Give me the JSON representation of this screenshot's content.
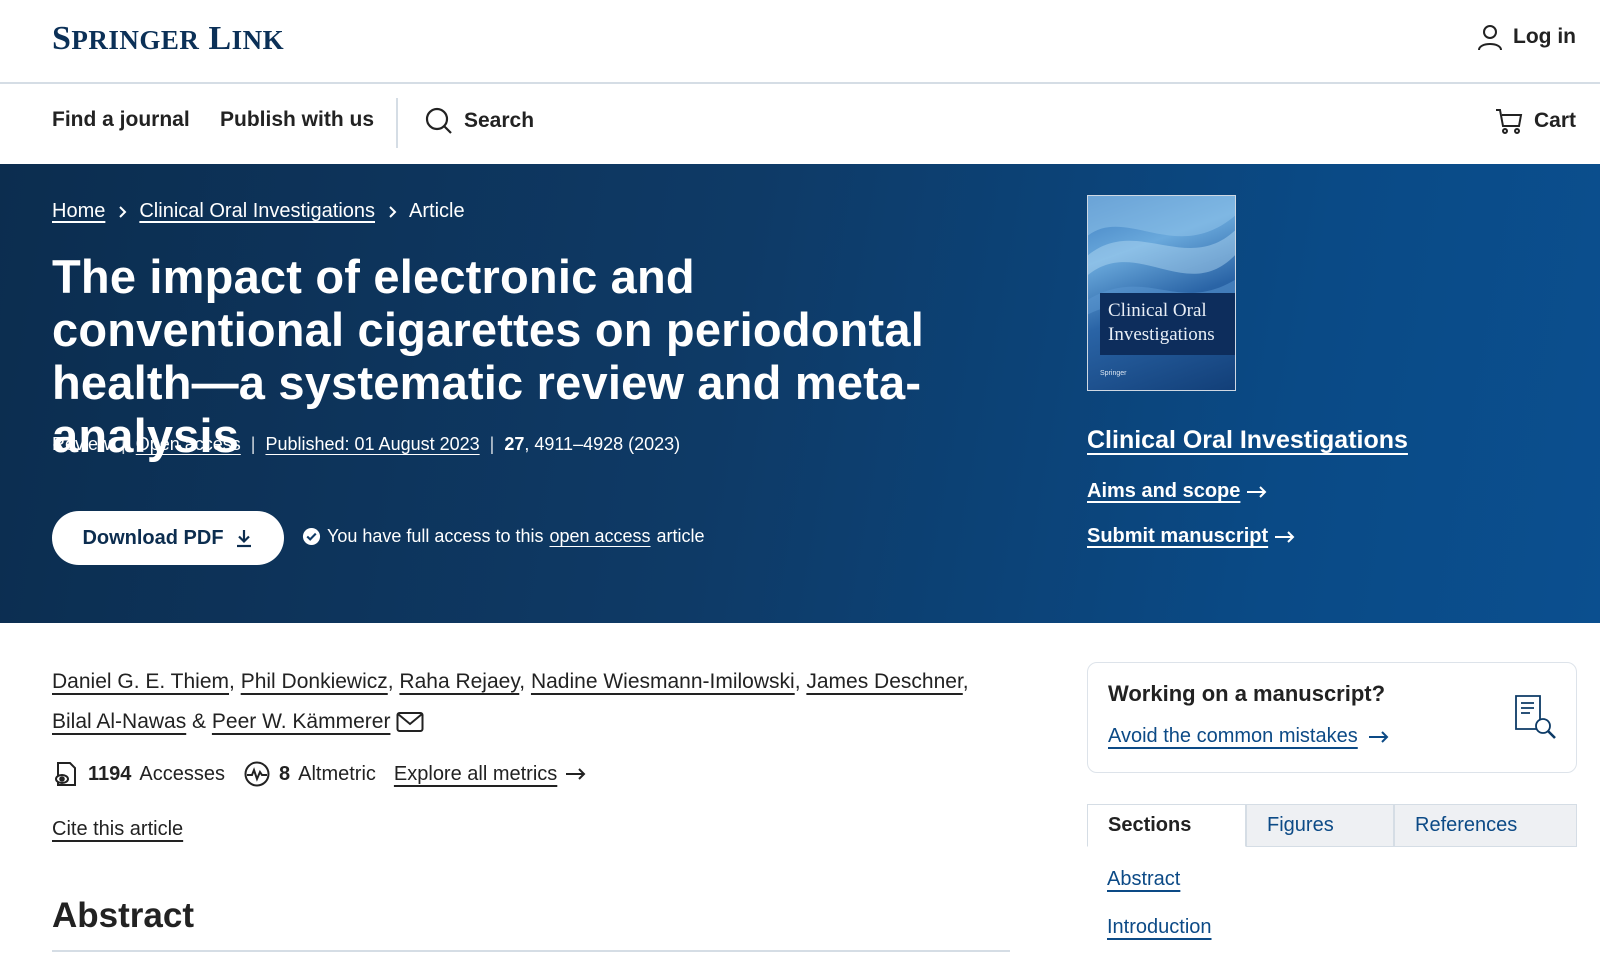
{
  "header": {
    "logo_text_1": "S",
    "logo_text_2": "PRINGER",
    "logo_text_3": " L",
    "logo_text_4": "INK",
    "login_label": "Log in"
  },
  "nav": {
    "find_journal": "Find a journal",
    "publish": "Publish with us",
    "search": "Search",
    "cart": "Cart"
  },
  "breadcrumb": {
    "home": "Home",
    "journal": "Clinical Oral Investigations",
    "current": "Article"
  },
  "article": {
    "title": "The impact of electronic and conventional cigarettes on periodontal health—a systematic review and meta-analysis",
    "type": "Review",
    "open_access": "Open access",
    "published": "Published: 01 August 2023",
    "volume": "27",
    "pages": ", 4911–4928 (2023)"
  },
  "download": {
    "label": "Download PDF",
    "access_prefix": "You have full access to this",
    "access_link": "open access",
    "access_suffix": "article"
  },
  "journal_panel": {
    "cover_line1": "Clinical Oral",
    "cover_line2": "Investigations",
    "cover_publisher": "Springer",
    "name": "Clinical Oral Investigations",
    "aims": "Aims and scope",
    "submit": "Submit manuscript"
  },
  "authors": {
    "list": [
      "Daniel G. E. Thiem",
      "Phil Donkiewicz",
      "Raha Rejaey",
      "Nadine Wiesmann-Imilowski",
      "James Deschner",
      "Bilal Al-Nawas",
      "Peer W. Kämmerer"
    ],
    "sep": ", ",
    "amp": " & "
  },
  "metrics": {
    "accesses_value": "1194",
    "accesses_label": "Accesses",
    "altmetric_value": "8",
    "altmetric_label": "Altmetric",
    "explore": "Explore all metrics"
  },
  "cite": "Cite this article",
  "abstract_heading": "Abstract",
  "promo": {
    "title": "Working on a manuscript?",
    "link": "Avoid the common mistakes"
  },
  "tabs": [
    "Sections",
    "Figures",
    "References"
  ],
  "toc": [
    "Abstract",
    "Introduction"
  ]
}
